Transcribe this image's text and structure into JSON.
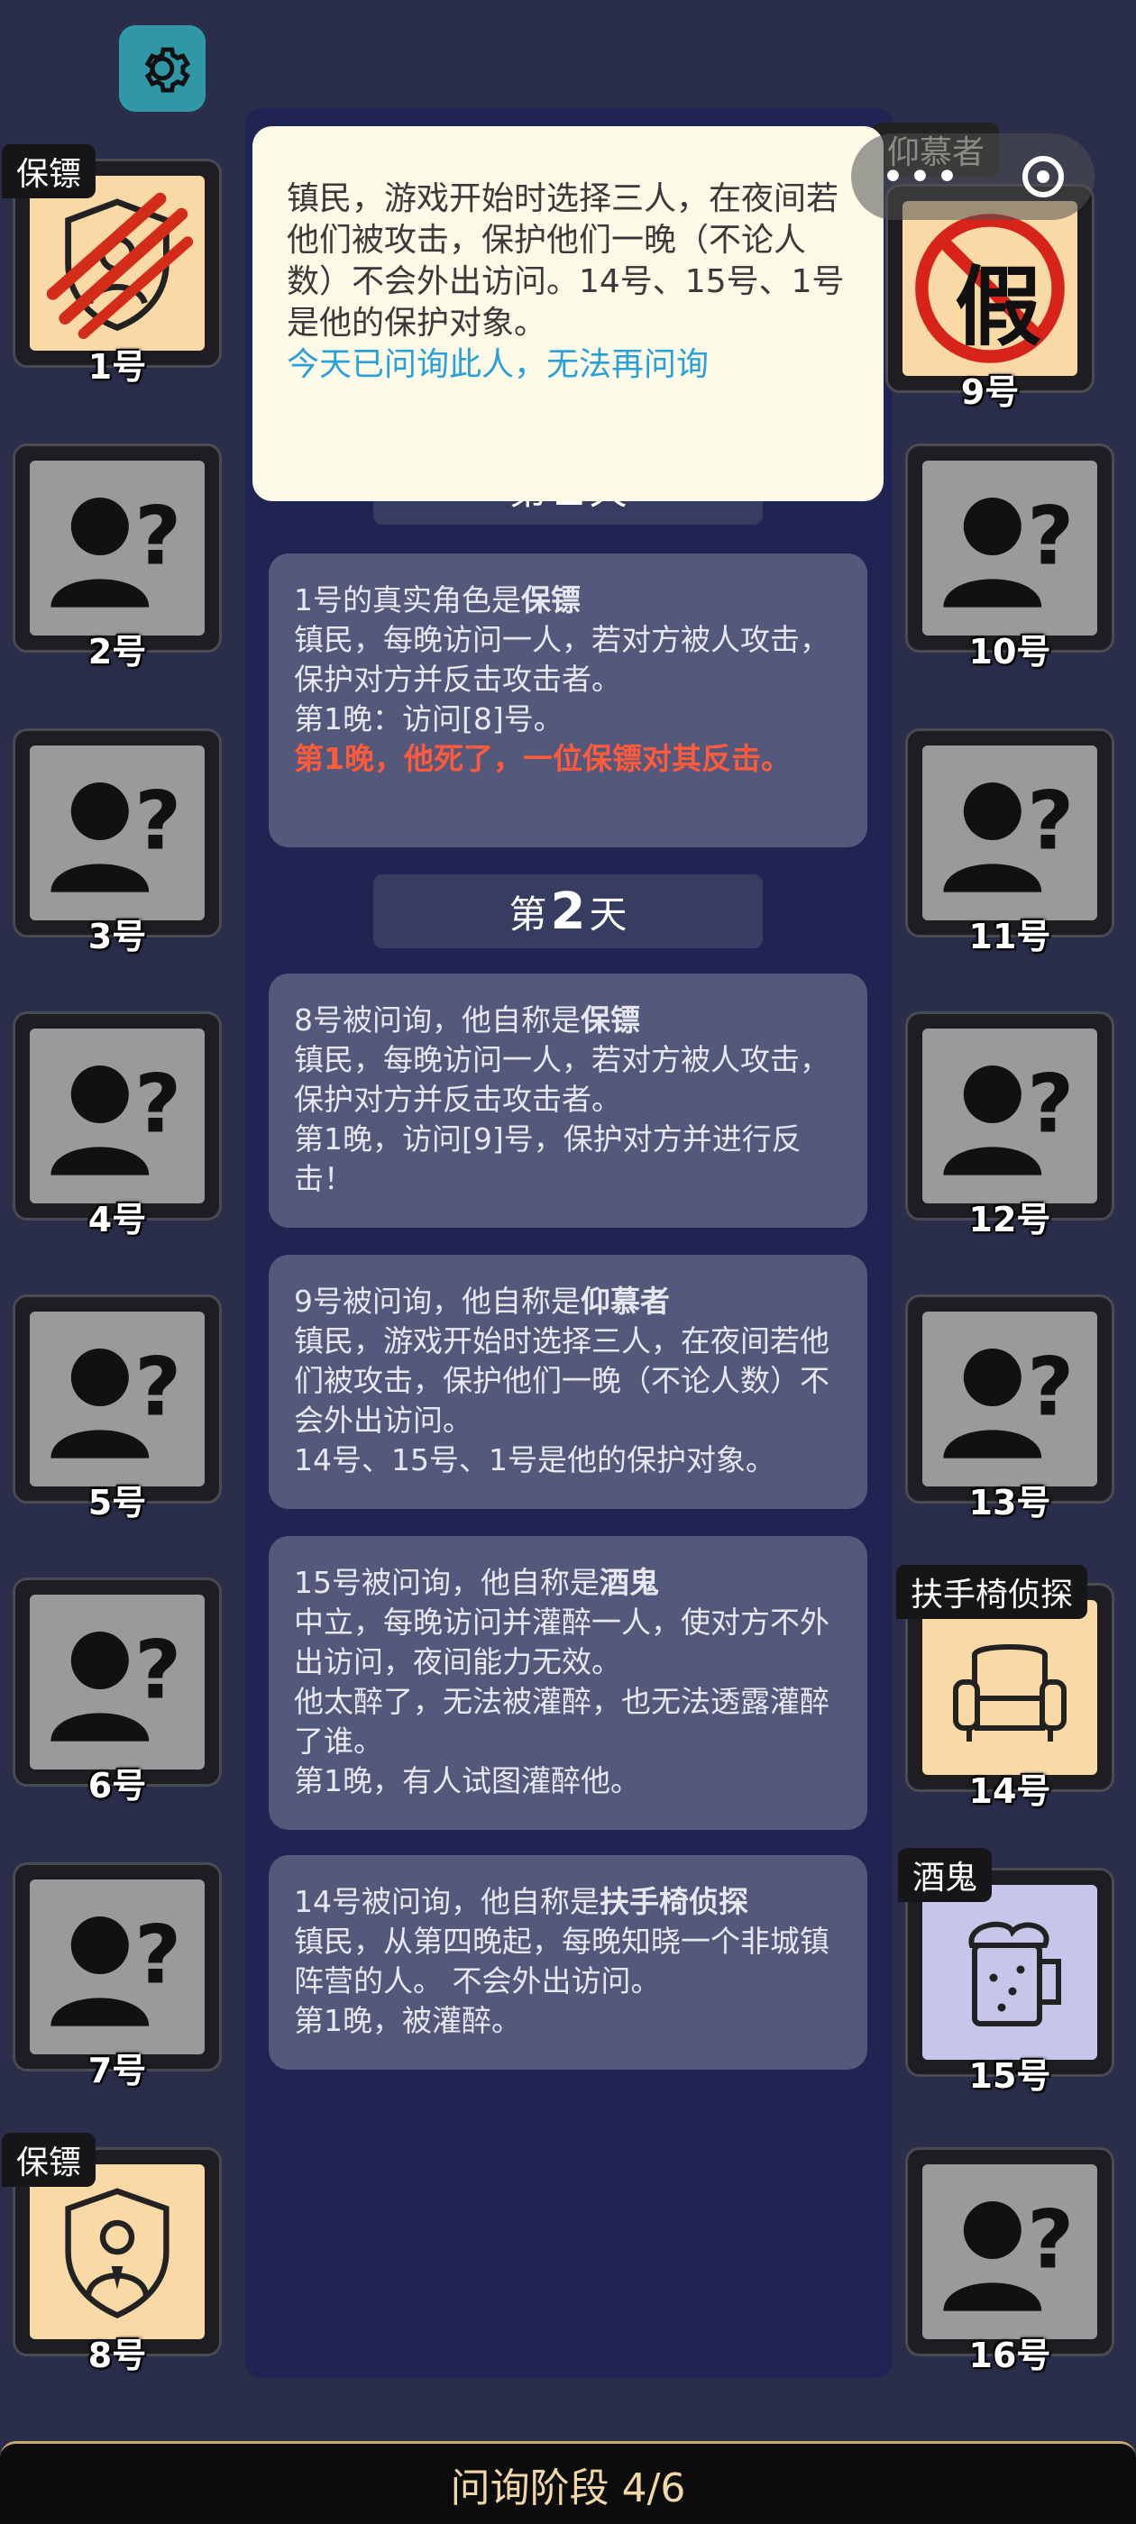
{
  "players": [
    {
      "n": "1号",
      "tag": "保镖"
    },
    {
      "n": "2号"
    },
    {
      "n": "3号"
    },
    {
      "n": "4号"
    },
    {
      "n": "5号"
    },
    {
      "n": "6号"
    },
    {
      "n": "7号"
    },
    {
      "n": "8号",
      "tag": "保镖"
    },
    {
      "n": "9号",
      "tag": "仰慕者",
      "stamp": "假"
    },
    {
      "n": "10号"
    },
    {
      "n": "11号"
    },
    {
      "n": "12号"
    },
    {
      "n": "13号"
    },
    {
      "n": "14号",
      "tag": "扶手椅侦探"
    },
    {
      "n": "15号",
      "tag": "酒鬼"
    },
    {
      "n": "16号"
    }
  ],
  "popup": {
    "text": "镇民，游戏开始时选择三人，在夜间若他们被攻击，保护他们一晚（不论人数）不会外出访问。14号、15号、1号是他的保护对象。",
    "notice": "今天已问询此人，无法再问询"
  },
  "day1_header_prefix": "第",
  "day1_header_num": "1",
  "day1_header_suffix": "天",
  "log1": {
    "prefix": "1号的真实角色是",
    "role": "保镖",
    "body": "镇民，每晚访问一人，若对方被人攻击，保护对方并反击攻击者。",
    "line2": "第1晚：访问[8]号。",
    "red": "第1晚，他死了，一位保镖对其反击。"
  },
  "day2_header": {
    "prefix": "第",
    "num": "2",
    "suffix": "天"
  },
  "log2": {
    "prefix": "8号被问询，他自称是",
    "role": "保镖",
    "body": "镇民，每晚访问一人，若对方被人攻击，保护对方并反击攻击者。",
    "line2": "第1晚，访问[9]号，保护对方并进行反击！"
  },
  "log3": {
    "prefix": "9号被问询，他自称是",
    "role": "仰慕者",
    "body": "镇民，游戏开始时选择三人，在夜间若他们被攻击，保护他们一晚（不论人数）不会外出访问。",
    "line2": "14号、15号、1号是他的保护对象。"
  },
  "log4": {
    "prefix": "15号被问询，他自称是",
    "role": "酒鬼",
    "body": "中立，每晚访问并灌醉一人，使对方不外出访问，夜间能力无效。",
    "line2": "他太醉了，无法被灌醉，也无法透露灌醉了谁。",
    "line3": "第1晚，有人试图灌醉他。"
  },
  "log5": {
    "prefix": "14号被问询，他自称是",
    "role": "扶手椅侦探",
    "body": "镇民，从第四晚起，每晚知晓一个非城镇阵营的人。 不会外出访问。",
    "line2": "第1晚，被灌醉。"
  },
  "bottom": {
    "phase": "问询阶段 4/6"
  },
  "colors": {
    "accent": "#2f97a6",
    "red": "#ff5a3c",
    "blue": "#2aa0d8",
    "gold": "#f1d8a6"
  }
}
